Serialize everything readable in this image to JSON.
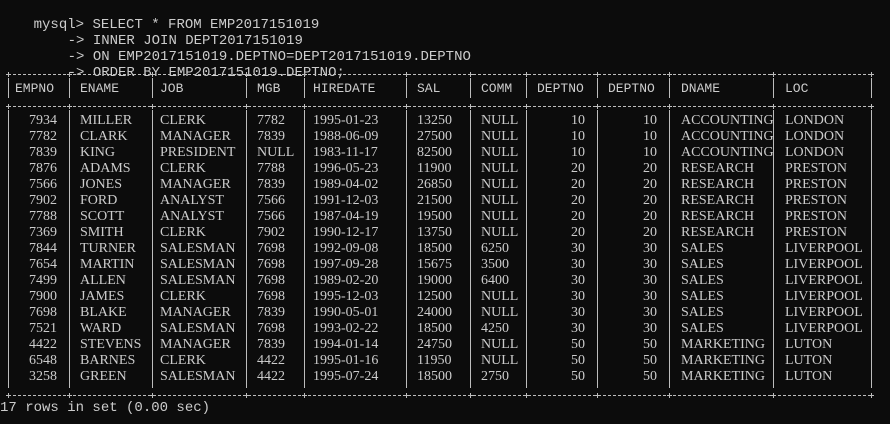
{
  "prompt": "mysql>",
  "continuation": "->",
  "query_lines": [
    "SELECT * FROM EMP2017151019",
    "INNER JOIN DEPT2017151019",
    "ON EMP2017151019.DEPTNO=DEPT2017151019.DEPTNO",
    "ORDER BY EMP2017151019.DEPTNO;"
  ],
  "table": {
    "columns": [
      "EMPNO",
      "ENAME",
      "JOB",
      "MGB",
      "HIREDATE",
      "SAL",
      "COMM",
      "DEPTNO",
      "DEPTNO",
      "DNAME",
      "LOC"
    ],
    "rows": [
      [
        "7934",
        "MILLER",
        "CLERK",
        "7782",
        "1995-01-23",
        "13250",
        "NULL",
        "10",
        "10",
        "ACCOUNTING",
        "LONDON"
      ],
      [
        "7782",
        "CLARK",
        "MANAGER",
        "7839",
        "1988-06-09",
        "27500",
        "NULL",
        "10",
        "10",
        "ACCOUNTING",
        "LONDON"
      ],
      [
        "7839",
        "KING",
        "PRESIDENT",
        "NULL",
        "1983-11-17",
        "82500",
        "NULL",
        "10",
        "10",
        "ACCOUNTING",
        "LONDON"
      ],
      [
        "7876",
        "ADAMS",
        "CLERK",
        "7788",
        "1996-05-23",
        "11900",
        "NULL",
        "20",
        "20",
        "RESEARCH",
        "PRESTON"
      ],
      [
        "7566",
        "JONES",
        "MANAGER",
        "7839",
        "1989-04-02",
        "26850",
        "NULL",
        "20",
        "20",
        "RESEARCH",
        "PRESTON"
      ],
      [
        "7902",
        "FORD",
        "ANALYST",
        "7566",
        "1991-12-03",
        "21500",
        "NULL",
        "20",
        "20",
        "RESEARCH",
        "PRESTON"
      ],
      [
        "7788",
        "SCOTT",
        "ANALYST",
        "7566",
        "1987-04-19",
        "19500",
        "NULL",
        "20",
        "20",
        "RESEARCH",
        "PRESTON"
      ],
      [
        "7369",
        "SMITH",
        "CLERK",
        "7902",
        "1990-12-17",
        "13750",
        "NULL",
        "20",
        "20",
        "RESEARCH",
        "PRESTON"
      ],
      [
        "7844",
        "TURNER",
        "SALESMAN",
        "7698",
        "1992-09-08",
        "18500",
        "6250",
        "30",
        "30",
        "SALES",
        "LIVERPOOL"
      ],
      [
        "7654",
        "MARTIN",
        "SALESMAN",
        "7698",
        "1997-09-28",
        "15675",
        "3500",
        "30",
        "30",
        "SALES",
        "LIVERPOOL"
      ],
      [
        "7499",
        "ALLEN",
        "SALESMAN",
        "7698",
        "1989-02-20",
        "19000",
        "6400",
        "30",
        "30",
        "SALES",
        "LIVERPOOL"
      ],
      [
        "7900",
        "JAMES",
        "CLERK",
        "7698",
        "1995-12-03",
        "12500",
        "NULL",
        "30",
        "30",
        "SALES",
        "LIVERPOOL"
      ],
      [
        "7698",
        "BLAKE",
        "MANAGER",
        "7839",
        "1990-05-01",
        "24000",
        "NULL",
        "30",
        "30",
        "SALES",
        "LIVERPOOL"
      ],
      [
        "7521",
        "WARD",
        "SALESMAN",
        "7698",
        "1993-02-22",
        "18500",
        "4250",
        "30",
        "30",
        "SALES",
        "LIVERPOOL"
      ],
      [
        "4422",
        "STEVENS",
        "MANAGER",
        "7839",
        "1994-01-14",
        "24750",
        "NULL",
        "50",
        "50",
        "MARKETING",
        "LUTON"
      ],
      [
        "6548",
        "BARNES",
        "CLERK",
        "4422",
        "1995-01-16",
        "11950",
        "NULL",
        "50",
        "50",
        "MARKETING",
        "LUTON"
      ],
      [
        "3258",
        "GREEN",
        "SALESMAN",
        "4422",
        "1995-07-24",
        "18500",
        "2750",
        "50",
        "50",
        "MARKETING",
        "LUTON"
      ]
    ]
  },
  "footer": "17 rows in set (0.00 sec)",
  "colors": {
    "background": "#0c0c0c",
    "text": "#cccccc",
    "border": "#bdbdbd"
  }
}
